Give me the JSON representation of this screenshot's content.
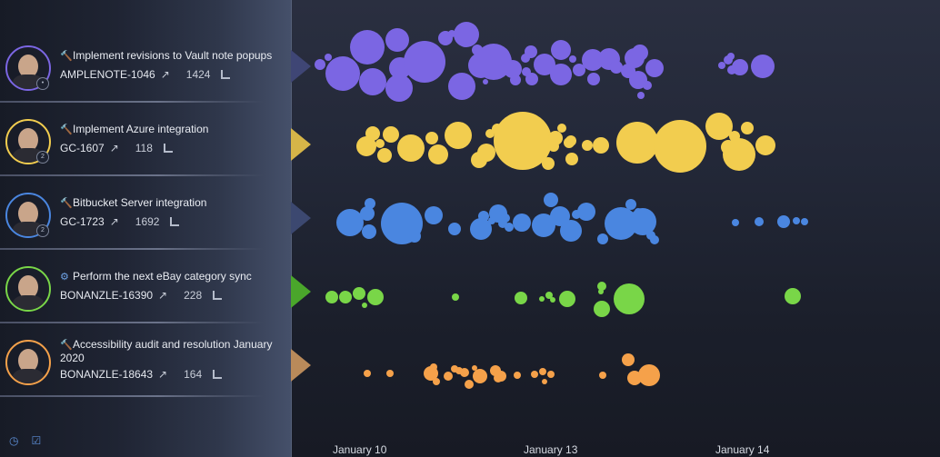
{
  "sidebar": {
    "items": [
      {
        "title": "Implement revisions to Vault note popups",
        "type_icon": "hammer-icon",
        "key": "AMPLENOTE-1046",
        "count": "1424",
        "ring_color": "#7b66e3",
        "badge": "•"
      },
      {
        "title": "Implement Azure integration",
        "type_icon": "hammer-icon",
        "key": "GC-1607",
        "count": "118",
        "ring_color": "#f2cd4f",
        "badge": "2"
      },
      {
        "title": "Bitbucket Server integration",
        "type_icon": "hammer-icon",
        "key": "GC-1723",
        "count": "1692",
        "ring_color": "#4a86e0",
        "badge": "2"
      },
      {
        "title": "Perform the next eBay category sync",
        "type_icon": "gears-icon",
        "key": "BONANZLE-16390",
        "count": "228",
        "ring_color": "#79d648",
        "badge": ""
      },
      {
        "title": "Accessibility audit and resolution January 2020",
        "type_icon": "hammer-icon",
        "key": "BONANZLE-18643",
        "count": "164",
        "ring_color": "#f5a14a",
        "badge": ""
      }
    ],
    "footer_icons": [
      "clock-icon",
      "clipboard-icon"
    ]
  },
  "timeline": {
    "x_labels": [
      "January 10",
      "January 13",
      "January 14"
    ]
  },
  "chart_data": {
    "type": "scatter",
    "title": "",
    "xlabel": "",
    "ylabel": "",
    "x_tick_labels": [
      "January 10",
      "January 13",
      "January 14"
    ],
    "series": [
      {
        "name": "AMPLENOTE-1046",
        "color": "#7b66e3",
        "bubbles": [
          [
            352,
            71,
            6
          ],
          [
            361,
            63,
            4
          ],
          [
            377,
            81,
            19
          ],
          [
            404,
            52,
            19
          ],
          [
            410,
            90,
            15
          ],
          [
            437,
            44,
            13
          ],
          [
            440,
            75,
            12
          ],
          [
            439,
            97,
            15
          ],
          [
            467,
            68,
            23
          ],
          [
            490,
            42,
            8
          ],
          [
            497,
            37,
            4
          ],
          [
            508,
            95,
            15
          ],
          [
            513,
            38,
            14
          ],
          [
            525,
            55,
            6
          ],
          [
            529,
            72,
            14
          ],
          [
            534,
            90,
            3
          ],
          [
            543,
            68,
            20
          ],
          [
            550,
            62,
            11
          ],
          [
            564,
            76,
            10
          ],
          [
            567,
            88,
            6
          ],
          [
            578,
            64,
            5
          ],
          [
            579,
            79,
            5
          ],
          [
            584,
            57,
            7
          ],
          [
            585,
            87,
            7
          ],
          [
            599,
            71,
            12
          ],
          [
            617,
            55,
            11
          ],
          [
            617,
            82,
            12
          ],
          [
            630,
            65,
            4
          ],
          [
            637,
            77,
            7
          ],
          [
            652,
            66,
            12
          ],
          [
            653,
            87,
            7
          ],
          [
            670,
            65,
            12
          ],
          [
            678,
            74,
            7
          ],
          [
            691,
            78,
            8
          ],
          [
            698,
            64,
            11
          ],
          [
            702,
            88,
            10
          ],
          [
            704,
            58,
            9
          ],
          [
            720,
            75,
            10
          ],
          [
            712,
            94,
            5
          ],
          [
            705,
            105,
            4
          ],
          [
            794,
            72,
            4
          ],
          [
            801,
            66,
            5
          ],
          [
            804,
            62,
            4
          ],
          [
            805,
            77,
            5
          ],
          [
            814,
            74,
            9
          ],
          [
            839,
            73,
            13
          ]
        ]
      },
      {
        "name": "GC-1607",
        "color": "#f2cd4f",
        "bubbles": [
          [
            403,
            161,
            11
          ],
          [
            410,
            147,
            8
          ],
          [
            418,
            158,
            5
          ],
          [
            423,
            171,
            8
          ],
          [
            430,
            148,
            9
          ],
          [
            452,
            163,
            15
          ],
          [
            475,
            152,
            7
          ],
          [
            482,
            170,
            11
          ],
          [
            504,
            149,
            15
          ],
          [
            527,
            176,
            9
          ],
          [
            535,
            168,
            10
          ],
          [
            539,
            147,
            5
          ],
          [
            547,
            142,
            6
          ],
          [
            556,
            159,
            6
          ],
          [
            559,
            166,
            5
          ],
          [
            561,
            152,
            5
          ],
          [
            575,
            155,
            32
          ],
          [
            611,
            152,
            8
          ],
          [
            609,
            161,
            6
          ],
          [
            618,
            141,
            5
          ],
          [
            626,
            157,
            6
          ],
          [
            628,
            155,
            6
          ],
          [
            629,
            175,
            7
          ],
          [
            646,
            160,
            6
          ],
          [
            661,
            160,
            9
          ],
          [
            701,
            157,
            23
          ],
          [
            748,
            161,
            29
          ],
          [
            791,
            139,
            15
          ],
          [
            801,
            162,
            8
          ],
          [
            808,
            150,
            6
          ],
          [
            813,
            170,
            18
          ],
          [
            822,
            141,
            7
          ],
          [
            842,
            160,
            11
          ],
          [
            603,
            180,
            7
          ]
        ]
      },
      {
        "name": "GC-1723",
        "color": "#4a86e0",
        "bubbles": [
          [
            385,
            245,
            15
          ],
          [
            404,
            235,
            8
          ],
          [
            407,
            224,
            6
          ],
          [
            406,
            255,
            8
          ],
          [
            442,
            246,
            23
          ],
          [
            456,
            260,
            7
          ],
          [
            477,
            237,
            10
          ],
          [
            500,
            252,
            7
          ],
          [
            529,
            252,
            12
          ],
          [
            532,
            238,
            6
          ],
          [
            541,
            243,
            4
          ],
          [
            548,
            235,
            10
          ],
          [
            553,
            246,
            5
          ],
          [
            556,
            240,
            5
          ],
          [
            560,
            250,
            5
          ],
          [
            574,
            245,
            10
          ],
          [
            598,
            248,
            13
          ],
          [
            606,
            220,
            8
          ],
          [
            616,
            238,
            11
          ],
          [
            628,
            254,
            12
          ],
          [
            634,
            236,
            5
          ],
          [
            645,
            233,
            10
          ],
          [
            663,
            263,
            6
          ],
          [
            683,
            246,
            18
          ],
          [
            694,
            225,
            6
          ],
          [
            702,
            233,
            4
          ],
          [
            707,
            244,
            15
          ],
          [
            716,
            259,
            5
          ],
          [
            720,
            264,
            5
          ],
          [
            809,
            245,
            4
          ],
          [
            835,
            244,
            5
          ],
          [
            862,
            244,
            7
          ],
          [
            876,
            243,
            4
          ],
          [
            885,
            244,
            4
          ]
        ]
      },
      {
        "name": "BONANZLE-16390",
        "color": "#79d648",
        "bubbles": [
          [
            365,
            327,
            7
          ],
          [
            380,
            327,
            7
          ],
          [
            395,
            323,
            7
          ],
          [
            413,
            327,
            9
          ],
          [
            401,
            336,
            3
          ],
          [
            501,
            327,
            4
          ],
          [
            573,
            328,
            7
          ],
          [
            596,
            329,
            3
          ],
          [
            604,
            325,
            4
          ],
          [
            608,
            330,
            3
          ],
          [
            624,
            329,
            9
          ],
          [
            662,
            315,
            5
          ],
          [
            661,
            321,
            3
          ],
          [
            662,
            340,
            9
          ],
          [
            692,
            329,
            17
          ],
          [
            872,
            326,
            9
          ]
        ]
      },
      {
        "name": "BONANZLE-18643",
        "color": "#f5a14a",
        "bubbles": [
          [
            404,
            411,
            4
          ],
          [
            429,
            411,
            4
          ],
          [
            474,
            411,
            8
          ],
          [
            477,
            404,
            4
          ],
          [
            480,
            420,
            4
          ],
          [
            493,
            414,
            5
          ],
          [
            500,
            406,
            4
          ],
          [
            505,
            408,
            4
          ],
          [
            511,
            410,
            5
          ],
          [
            516,
            423,
            5
          ],
          [
            522,
            405,
            3
          ],
          [
            528,
            414,
            8
          ],
          [
            545,
            408,
            6
          ],
          [
            548,
            416,
            5
          ],
          [
            551,
            414,
            6
          ],
          [
            569,
            413,
            4
          ],
          [
            588,
            412,
            4
          ],
          [
            597,
            409,
            4
          ],
          [
            599,
            420,
            3
          ],
          [
            606,
            412,
            4
          ],
          [
            663,
            413,
            4
          ],
          [
            691,
            396,
            7
          ],
          [
            698,
            416,
            8
          ],
          [
            714,
            413,
            12
          ]
        ]
      }
    ]
  }
}
